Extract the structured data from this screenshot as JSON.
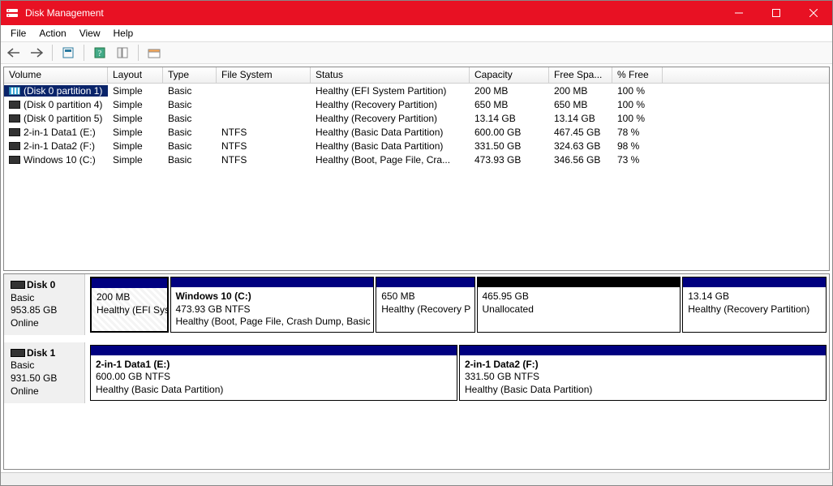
{
  "app": {
    "title": "Disk Management"
  },
  "menu": {
    "file": "File",
    "action": "Action",
    "view": "View",
    "help": "Help"
  },
  "columns": {
    "volume": "Volume",
    "layout": "Layout",
    "type": "Type",
    "fs": "File System",
    "status": "Status",
    "capacity": "Capacity",
    "free": "Free Spa...",
    "pfree": "% Free"
  },
  "volumes": [
    {
      "name": "(Disk 0 partition 1)",
      "layout": "Simple",
      "type": "Basic",
      "fs": "",
      "status": "Healthy (EFI System Partition)",
      "capacity": "200 MB",
      "free": "200 MB",
      "pfree": "100 %",
      "selected": true,
      "iconDark": false
    },
    {
      "name": "(Disk 0 partition 4)",
      "layout": "Simple",
      "type": "Basic",
      "fs": "",
      "status": "Healthy (Recovery Partition)",
      "capacity": "650 MB",
      "free": "650 MB",
      "pfree": "100 %",
      "selected": false,
      "iconDark": true
    },
    {
      "name": "(Disk 0 partition 5)",
      "layout": "Simple",
      "type": "Basic",
      "fs": "",
      "status": "Healthy (Recovery Partition)",
      "capacity": "13.14 GB",
      "free": "13.14 GB",
      "pfree": "100 %",
      "selected": false,
      "iconDark": true
    },
    {
      "name": "2-in-1 Data1 (E:)",
      "layout": "Simple",
      "type": "Basic",
      "fs": "NTFS",
      "status": "Healthy (Basic Data Partition)",
      "capacity": "600.00 GB",
      "free": "467.45 GB",
      "pfree": "78 %",
      "selected": false,
      "iconDark": true
    },
    {
      "name": "2-in-1 Data2 (F:)",
      "layout": "Simple",
      "type": "Basic",
      "fs": "NTFS",
      "status": "Healthy (Basic Data Partition)",
      "capacity": "331.50 GB",
      "free": "324.63 GB",
      "pfree": "98 %",
      "selected": false,
      "iconDark": true
    },
    {
      "name": "Windows 10 (C:)",
      "layout": "Simple",
      "type": "Basic",
      "fs": "NTFS",
      "status": "Healthy (Boot, Page File, Cra...",
      "capacity": "473.93 GB",
      "free": "346.56 GB",
      "pfree": "73 %",
      "selected": false,
      "iconDark": true
    }
  ],
  "disks": [
    {
      "name": "Disk 0",
      "type": "Basic",
      "size": "953.85 GB",
      "state": "Online",
      "parts": [
        {
          "title": "",
          "sub": "200 MB",
          "status": "Healthy (EFI Syst",
          "flex": 10,
          "head": "navy",
          "hatched": true,
          "thick": true
        },
        {
          "title": "Windows 10  (C:)",
          "sub": "473.93 GB NTFS",
          "status": "Healthy (Boot, Page File, Crash Dump, Basic I",
          "flex": 27,
          "head": "navy",
          "hatched": false,
          "thick": false
        },
        {
          "title": "",
          "sub": "650 MB",
          "status": "Healthy (Recovery P",
          "flex": 13,
          "head": "navy",
          "hatched": false,
          "thick": false
        },
        {
          "title": "",
          "sub": "465.95 GB",
          "status": "Unallocated",
          "flex": 27,
          "head": "black",
          "hatched": false,
          "thick": false
        },
        {
          "title": "",
          "sub": "13.14 GB",
          "status": "Healthy (Recovery Partition)",
          "flex": 19,
          "head": "navy",
          "hatched": false,
          "thick": false
        }
      ]
    },
    {
      "name": "Disk 1",
      "type": "Basic",
      "size": "931.50 GB",
      "state": "Online",
      "parts": [
        {
          "title": "2-in-1 Data1  (E:)",
          "sub": "600.00 GB NTFS",
          "status": "Healthy (Basic Data Partition)",
          "flex": 50,
          "head": "navy",
          "hatched": false,
          "thick": false
        },
        {
          "title": "2-in-1 Data2  (F:)",
          "sub": "331.50 GB NTFS",
          "status": "Healthy (Basic Data Partition)",
          "flex": 50,
          "head": "navy",
          "hatched": false,
          "thick": false
        }
      ]
    }
  ]
}
